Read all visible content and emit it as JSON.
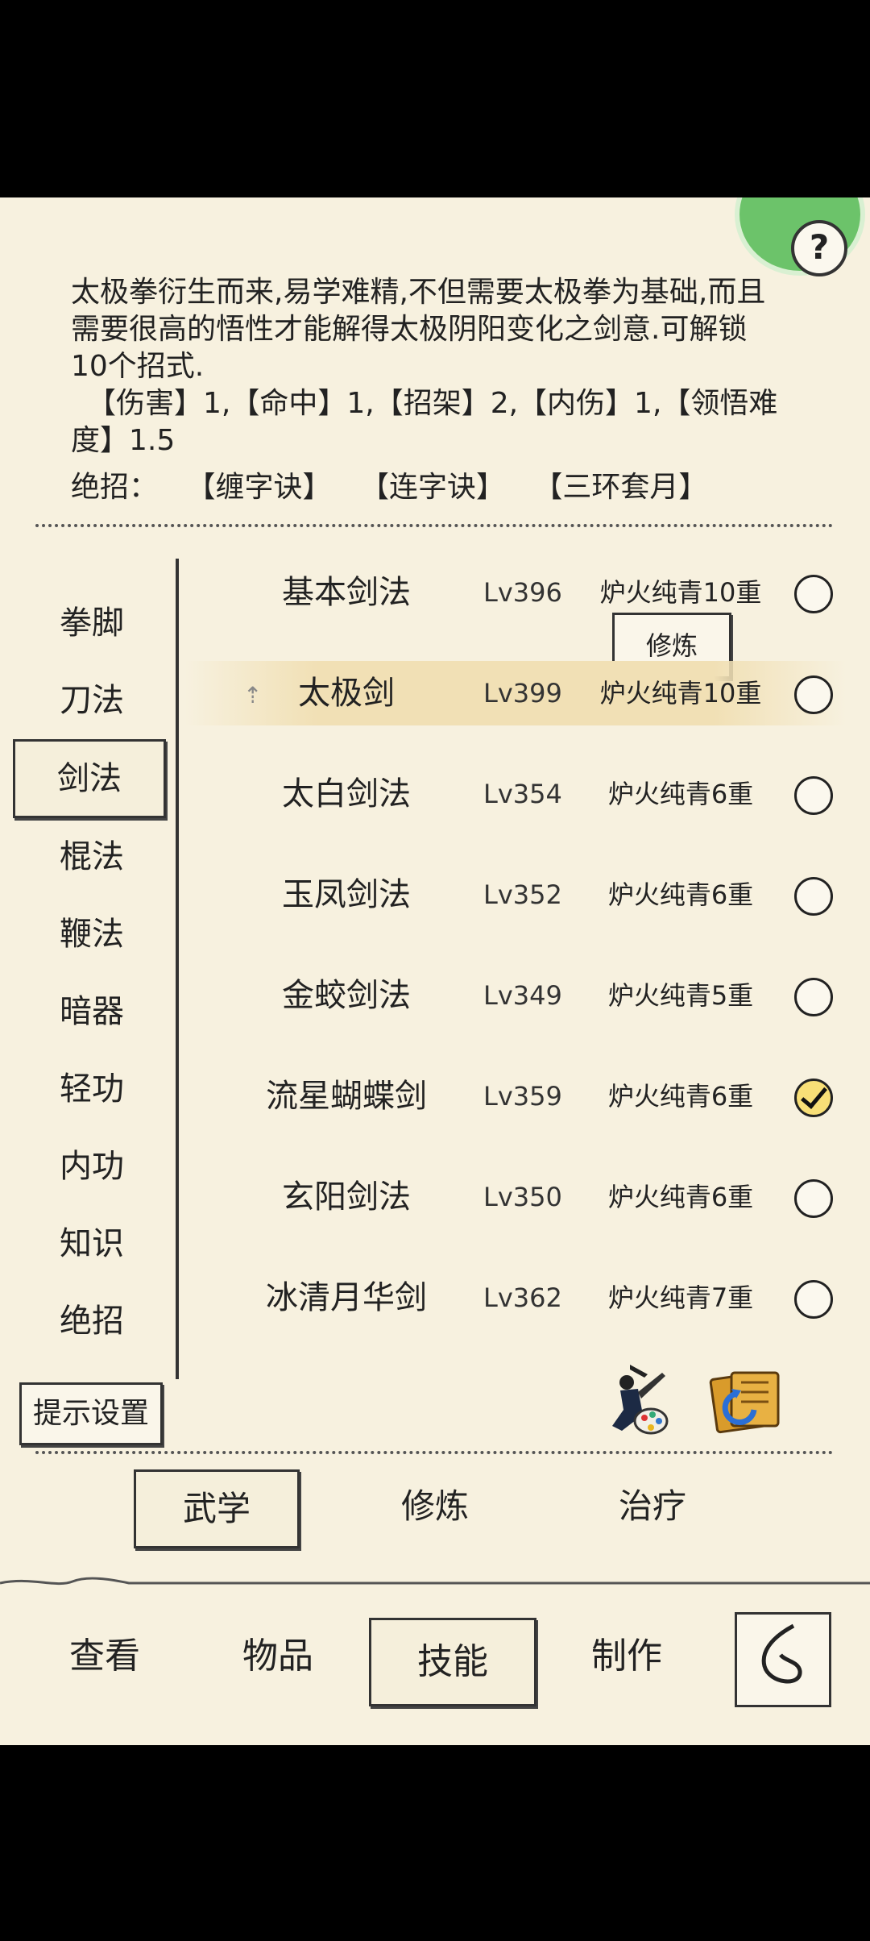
{
  "description": {
    "line1": "太极拳衍生而来,易学难精,不但需要太极拳为基础,而且",
    "line2": "需要很高的悟性才能解得太极阴阳变化之剑意.可解锁",
    "line3": "10个招式.",
    "line4": "【伤害】1,【命中】1,【招架】2,【内伤】1,【领悟难",
    "line5": "度】1.5"
  },
  "ultimate": {
    "label": "绝招：",
    "items": [
      "【缠字诀】",
      "【连字诀】",
      "【三环套月】"
    ]
  },
  "help_label": "?",
  "categories": [
    {
      "label": "拳脚"
    },
    {
      "label": "刀法"
    },
    {
      "label": "剑法",
      "active": true
    },
    {
      "label": "棍法"
    },
    {
      "label": "鞭法"
    },
    {
      "label": "暗器"
    },
    {
      "label": "轻功"
    },
    {
      "label": "内功"
    },
    {
      "label": "知识"
    },
    {
      "label": "绝招"
    }
  ],
  "hint_settings_label": "提示设置",
  "train_popup_label": "修炼",
  "skills": [
    {
      "name": "基本剑法",
      "level": "Lv396",
      "rank": "炉火纯青10重",
      "selected": false
    },
    {
      "name": "太极剑",
      "level": "Lv399",
      "rank": "炉火纯青10重",
      "selected": false,
      "highlighted": true
    },
    {
      "name": "太白剑法",
      "level": "Lv354",
      "rank": "炉火纯青6重",
      "selected": false
    },
    {
      "name": "玉凤剑法",
      "level": "Lv352",
      "rank": "炉火纯青6重",
      "selected": false
    },
    {
      "name": "金蛟剑法",
      "level": "Lv349",
      "rank": "炉火纯青5重",
      "selected": false
    },
    {
      "name": "流星蝴蝶剑",
      "level": "Lv359",
      "rank": "炉火纯青6重",
      "selected": true
    },
    {
      "name": "玄阳剑法",
      "level": "Lv350",
      "rank": "炉火纯青6重",
      "selected": false
    },
    {
      "name": "冰清月华剑",
      "level": "Lv362",
      "rank": "炉火纯青7重",
      "selected": false
    }
  ],
  "sub_tabs": [
    {
      "label": "武学",
      "active": true
    },
    {
      "label": "修炼"
    },
    {
      "label": "治疗"
    }
  ],
  "bottom_nav": [
    {
      "label": "查看"
    },
    {
      "label": "物品"
    },
    {
      "label": "技能",
      "active": true
    },
    {
      "label": "制作"
    }
  ],
  "colors": {
    "background": "#f7f1df",
    "highlight": "#f1e0b5",
    "check_selected": "#f8df77",
    "badge_green": "#6cc36a"
  }
}
